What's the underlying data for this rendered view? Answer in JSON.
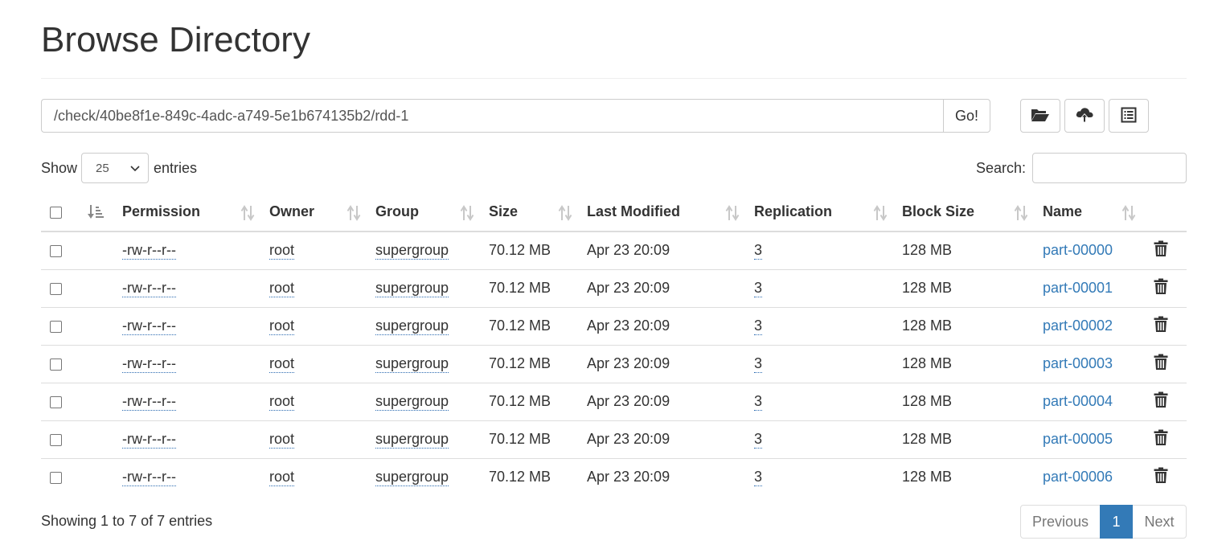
{
  "page": {
    "title": "Browse Directory"
  },
  "pathbar": {
    "path": "/check/40be8f1e-849c-4adc-a749-5e1b674135b2/rdd-1",
    "go_label": "Go!"
  },
  "toolbar": {
    "icons": [
      "folder-open-icon",
      "cloud-upload-icon",
      "list-alt-icon"
    ]
  },
  "length": {
    "show_label": "Show",
    "value": "25",
    "entries_label": "entries"
  },
  "search": {
    "label": "Search:",
    "value": ""
  },
  "table": {
    "columns": [
      "Permission",
      "Owner",
      "Group",
      "Size",
      "Last Modified",
      "Replication",
      "Block Size",
      "Name"
    ],
    "rows": [
      {
        "permission": "-rw-r--r--",
        "owner": "root",
        "group": "supergroup",
        "size": "70.12 MB",
        "modified": "Apr 23 20:09",
        "replication": "3",
        "block_size": "128 MB",
        "name": "part-00000"
      },
      {
        "permission": "-rw-r--r--",
        "owner": "root",
        "group": "supergroup",
        "size": "70.12 MB",
        "modified": "Apr 23 20:09",
        "replication": "3",
        "block_size": "128 MB",
        "name": "part-00001"
      },
      {
        "permission": "-rw-r--r--",
        "owner": "root",
        "group": "supergroup",
        "size": "70.12 MB",
        "modified": "Apr 23 20:09",
        "replication": "3",
        "block_size": "128 MB",
        "name": "part-00002"
      },
      {
        "permission": "-rw-r--r--",
        "owner": "root",
        "group": "supergroup",
        "size": "70.12 MB",
        "modified": "Apr 23 20:09",
        "replication": "3",
        "block_size": "128 MB",
        "name": "part-00003"
      },
      {
        "permission": "-rw-r--r--",
        "owner": "root",
        "group": "supergroup",
        "size": "70.12 MB",
        "modified": "Apr 23 20:09",
        "replication": "3",
        "block_size": "128 MB",
        "name": "part-00004"
      },
      {
        "permission": "-rw-r--r--",
        "owner": "root",
        "group": "supergroup",
        "size": "70.12 MB",
        "modified": "Apr 23 20:09",
        "replication": "3",
        "block_size": "128 MB",
        "name": "part-00005"
      },
      {
        "permission": "-rw-r--r--",
        "owner": "root",
        "group": "supergroup",
        "size": "70.12 MB",
        "modified": "Apr 23 20:09",
        "replication": "3",
        "block_size": "128 MB",
        "name": "part-00006"
      }
    ]
  },
  "footer": {
    "info": "Showing 1 to 7 of 7 entries",
    "previous": "Previous",
    "current_page": "1",
    "next": "Next"
  },
  "colors": {
    "link": "#337ab7",
    "active_page": "#337ab7",
    "border": "#dddddd"
  }
}
